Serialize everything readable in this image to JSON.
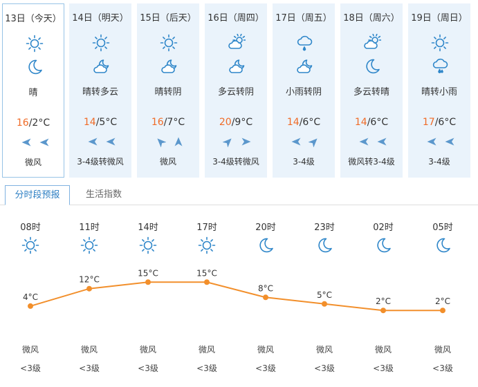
{
  "days": [
    {
      "date": "13日（今天）",
      "weather": "晴",
      "high": "16",
      "low": "2°C",
      "wind": "微风",
      "icons": [
        "sun-icon",
        "moon-icon"
      ],
      "winds": [
        "west",
        "west"
      ],
      "selected": true
    },
    {
      "date": "14日（明天）",
      "weather": "晴转多云",
      "high": "14",
      "low": "5°C",
      "wind": "3-4级转微风",
      "icons": [
        "sun-icon",
        "cloudy-night-icon"
      ],
      "winds": [
        "west",
        "west"
      ],
      "selected": false
    },
    {
      "date": "15日（后天）",
      "weather": "晴转阴",
      "high": "16",
      "low": "7°C",
      "wind": "微风",
      "icons": [
        "sun-icon",
        "cloudy-night-icon"
      ],
      "winds": [
        "northwest",
        "north"
      ],
      "selected": false
    },
    {
      "date": "16日（周四）",
      "weather": "多云转阴",
      "high": "20",
      "low": "9°C",
      "wind": "3-4级转微风",
      "icons": [
        "partly-cloudy-icon",
        "cloudy-night-icon"
      ],
      "winds": [
        "northeast",
        "east"
      ],
      "selected": false
    },
    {
      "date": "17日（周五）",
      "weather": "小雨转阴",
      "high": "14",
      "low": "6°C",
      "wind": "3-4级",
      "icons": [
        "light-rain-icon",
        "cloudy-night-icon"
      ],
      "winds": [
        "west",
        "northeast"
      ],
      "selected": false
    },
    {
      "date": "18日（周六）",
      "weather": "多云转晴",
      "high": "14",
      "low": "6°C",
      "wind": "微风转3-4级",
      "icons": [
        "partly-cloudy-icon",
        "moon-icon"
      ],
      "winds": [
        "west",
        "west"
      ],
      "selected": false
    },
    {
      "date": "19日（周日）",
      "weather": "晴转小雨",
      "high": "17",
      "low": "6°C",
      "wind": "3-4级",
      "icons": [
        "sun-icon",
        "rain-night-icon"
      ],
      "winds": [
        "west",
        "west"
      ],
      "selected": false
    }
  ],
  "tabs": {
    "active": "分时段预报",
    "inactive": "生活指数"
  },
  "hourly": [
    {
      "time": "08时",
      "icon": "sun-icon",
      "wind": "微风",
      "level": "<3级"
    },
    {
      "time": "11时",
      "icon": "sun-icon",
      "wind": "微风",
      "level": "<3级"
    },
    {
      "time": "14时",
      "icon": "sun-icon",
      "wind": "微风",
      "level": "<3级"
    },
    {
      "time": "17时",
      "icon": "sun-icon",
      "wind": "微风",
      "level": "<3级"
    },
    {
      "time": "20时",
      "icon": "moon-icon",
      "wind": "微风",
      "level": "<3级"
    },
    {
      "time": "23时",
      "icon": "moon-icon",
      "wind": "微风",
      "level": "<3级"
    },
    {
      "time": "02时",
      "icon": "moon-icon",
      "wind": "微风",
      "level": "<3级"
    },
    {
      "time": "05时",
      "icon": "moon-icon",
      "wind": "微风",
      "level": "<3级"
    }
  ],
  "chart_data": {
    "type": "line",
    "x": [
      "08时",
      "11时",
      "14时",
      "17时",
      "20时",
      "23时",
      "02时",
      "05时"
    ],
    "values": [
      4,
      12,
      15,
      15,
      8,
      5,
      2,
      2
    ],
    "labels": [
      "4°C",
      "12°C",
      "15°C",
      "15°C",
      "8°C",
      "5°C",
      "2°C",
      "2°C"
    ]
  },
  "colors": {
    "accent": "#2d7fc3",
    "icon": "#2e86c9",
    "high_temp": "#f06b27",
    "line": "#f28f2b",
    "card_bg": "#eaf3fb",
    "wind_arrow": "#5b97cc"
  }
}
